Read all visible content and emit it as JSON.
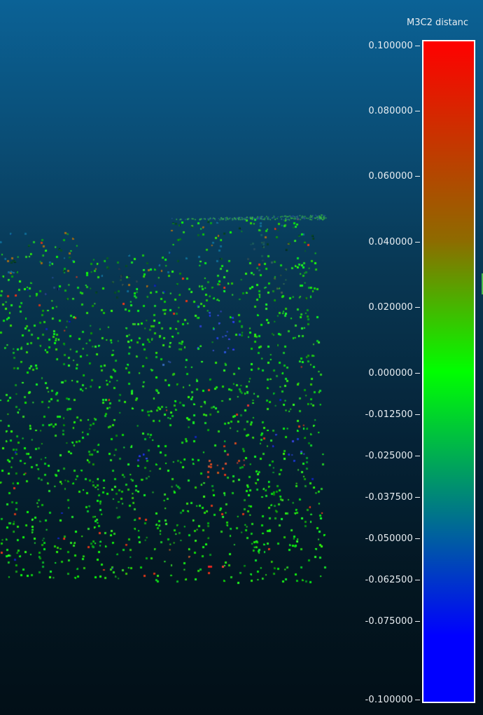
{
  "scalar_field": {
    "name": "M3C2 distanc",
    "colors": [
      "#ff0000",
      "#8f6a00",
      "#00ff00",
      "#0000ff"
    ],
    "ticks": [
      {
        "value": 0.1,
        "label": "0.100000"
      },
      {
        "value": 0.08,
        "label": "0.080000"
      },
      {
        "value": 0.06,
        "label": "0.060000"
      },
      {
        "value": 0.04,
        "label": "0.040000"
      },
      {
        "value": 0.02,
        "label": "0.020000"
      },
      {
        "value": 0.0,
        "label": "0.000000"
      },
      {
        "value": -0.0125,
        "label": "-0.012500"
      },
      {
        "value": -0.025,
        "label": "-0.025000"
      },
      {
        "value": -0.0375,
        "label": "-0.037500"
      },
      {
        "value": -0.05,
        "label": "-0.050000"
      },
      {
        "value": -0.0625,
        "label": "-0.062500"
      },
      {
        "value": -0.075,
        "label": "-0.075000"
      },
      {
        "value": -0.1,
        "label": "-0.100000"
      }
    ]
  }
}
